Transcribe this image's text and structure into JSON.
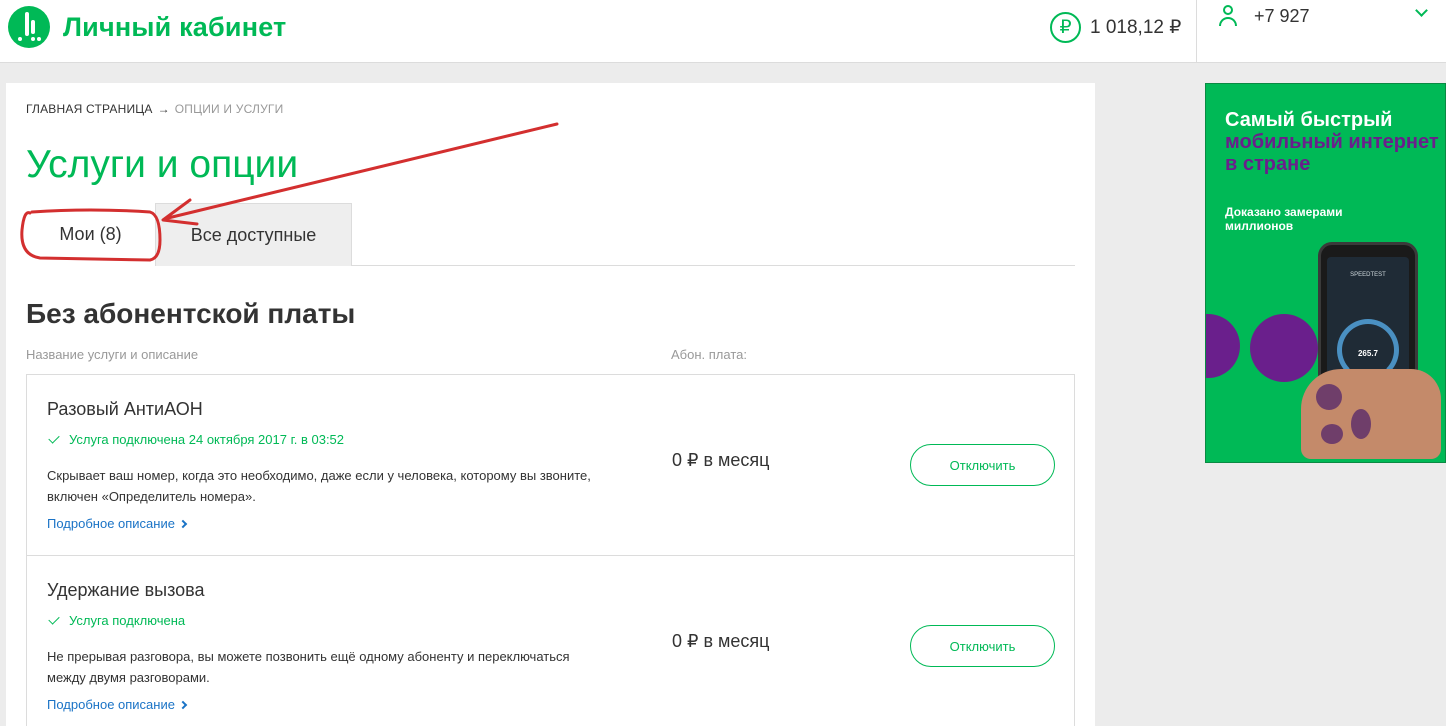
{
  "header": {
    "app_title": "Личный кабинет",
    "balance": "1 018,12 ₽",
    "ruble_symbol": "₽",
    "phone": "+7 927"
  },
  "breadcrumb": {
    "home": "Главная страница",
    "separator": "→",
    "current": "Опции и услуги"
  },
  "page_title": "Услуги и опции",
  "tabs": [
    {
      "label": "Мои (8)",
      "active": true
    },
    {
      "label": "Все доступные",
      "active": false
    }
  ],
  "section": {
    "title": "Без абонентской платы",
    "col_name": "Название услуги и описание",
    "col_fee": "Абон. плата:"
  },
  "services": [
    {
      "name": "Разовый АнтиАОН",
      "status": "Услуга подключена 24 октября 2017 г. в 03:52",
      "description": "Скрывает ваш номер, когда это необходимо, даже если у человека, которому вы звоните, включен «Определитель номера».",
      "more": "Подробное описание",
      "fee": "0 ₽ в месяц",
      "button": "Отключить"
    },
    {
      "name": "Удержание вызова",
      "status": "Услуга подключена",
      "description": "Не прерывая разговора, вы можете позвонить ещё одному абоненту и переключаться между двумя разговорами.",
      "more": "Подробное описание",
      "fee": "0 ₽ в месяц",
      "button": "Отключить"
    }
  ],
  "ad": {
    "line1": "Самый быстрый",
    "line2": "мобильный интернет в стране",
    "subline": "Доказано замерами миллионов",
    "speedtest_label": "SPEEDTEST",
    "speed_value": "265.7"
  },
  "colors": {
    "brand_green": "#00b956",
    "ad_purple": "#6a1f8c",
    "annotation_red": "#d32f2f",
    "link_blue": "#1a73c6"
  },
  "icons": [
    "megafon-logo-icon",
    "ruble-icon",
    "user-icon",
    "chevron-down-icon",
    "check-icon",
    "chevron-right-icon"
  ]
}
